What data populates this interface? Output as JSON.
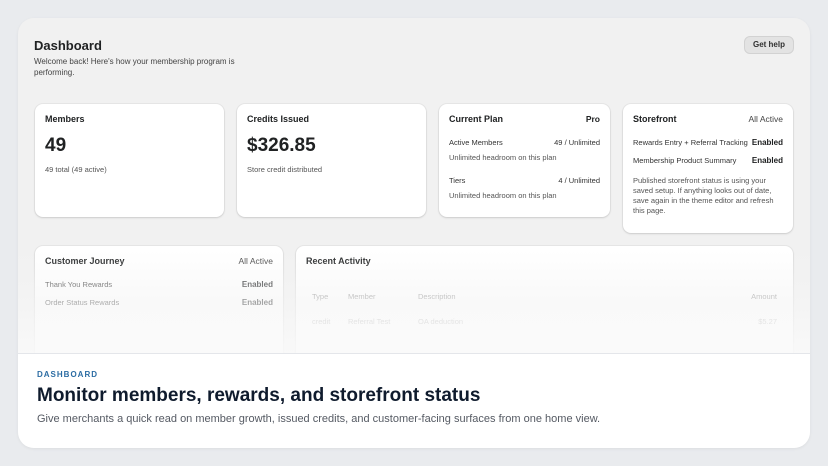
{
  "header": {
    "title": "Dashboard",
    "subtitle": "Welcome back! Here's how your membership program is performing.",
    "help_label": "Get help"
  },
  "members": {
    "title": "Members",
    "value": "49",
    "detail": "49 total (49 active)"
  },
  "credits": {
    "title": "Credits Issued",
    "value": "$326.85",
    "detail": "Store credit distributed"
  },
  "plan": {
    "title": "Current Plan",
    "badge": "Pro",
    "active_label": "Active Members",
    "active_value": "49 / Unlimited",
    "active_note": "Unlimited headroom on this plan",
    "tiers_label": "Tiers",
    "tiers_value": "4 / Unlimited",
    "tiers_note": "Unlimited headroom on this plan"
  },
  "storefront": {
    "title": "Storefront",
    "badge": "All Active",
    "items": [
      {
        "label": "Rewards Entry + Referral Tracking",
        "status": "Enabled"
      },
      {
        "label": "Membership Product Summary",
        "status": "Enabled"
      }
    ],
    "note": "Published storefront status is using your saved setup. If anything looks out of date, save again in the theme editor and refresh this page."
  },
  "journey": {
    "title": "Customer Journey",
    "badge": "All Active",
    "items": [
      {
        "label": "Thank You Rewards",
        "status": "Enabled"
      },
      {
        "label": "Order Status Rewards",
        "status": "Enabled"
      }
    ]
  },
  "activity": {
    "title": "Recent Activity",
    "columns": [
      "Type",
      "Member",
      "Description",
      "Amount"
    ],
    "rows": [
      {
        "type": "credit",
        "member": "Referral Test",
        "description": "OA deduction",
        "amount": "$5.27"
      }
    ]
  },
  "caption": {
    "eyebrow": "DASHBOARD",
    "headline": "Monitor members, rewards, and storefront status",
    "text": "Give merchants a quick read on member growth, issued credits, and customer-facing surfaces from one home view."
  }
}
